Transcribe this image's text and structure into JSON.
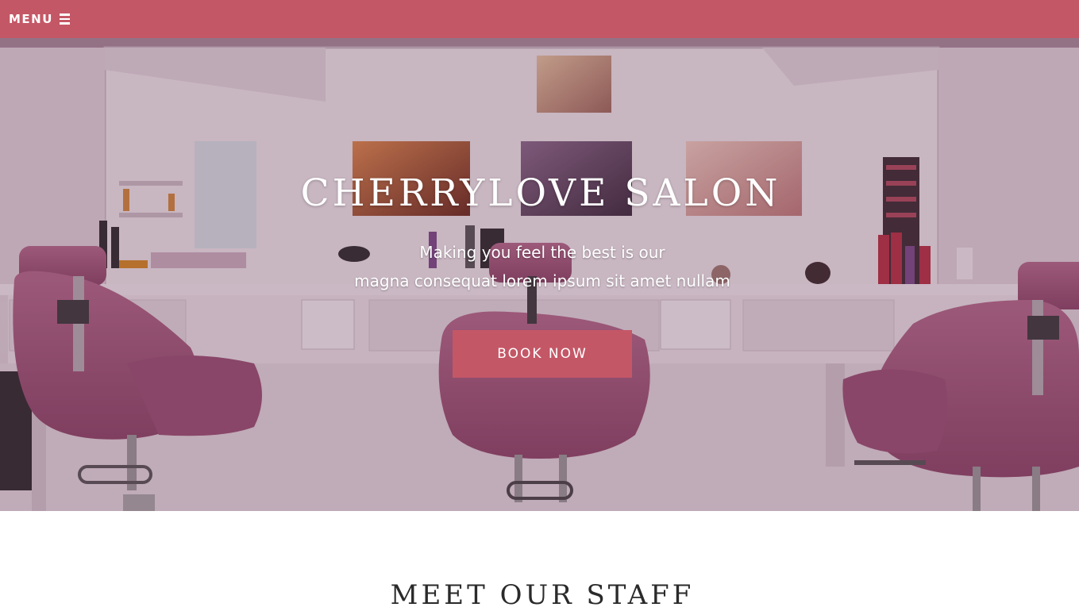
{
  "nav": {
    "menu_label": "MENU"
  },
  "hero": {
    "title": "CHERRYLOVE SALON",
    "subtitle_line1": "Making you feel the best is our",
    "subtitle_line2": "magna consequat lorem ipsum sit amet nullam",
    "button_label": "BOOK NOW"
  },
  "staff": {
    "title": "MEET OUR STAFF"
  },
  "colors": {
    "brand": "#c45766",
    "hero_tint": "#5f2d50",
    "heading_text": "#2a2a2a"
  },
  "icons": {
    "menu": "hamburger-icon"
  }
}
